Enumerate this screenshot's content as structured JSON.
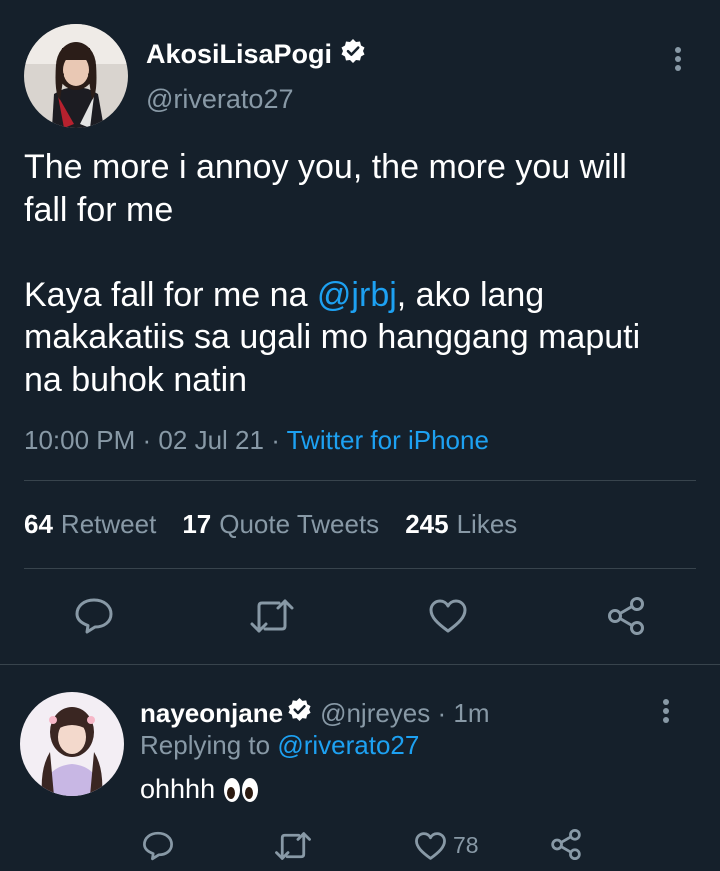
{
  "tweet": {
    "display_name": "AkosiLisaPogi",
    "handle": "@riverato27",
    "text_line1": "The more i annoy you, the more you will",
    "text_line2": "fall for me",
    "text_line3_pre": "Kaya fall for me na ",
    "mention": "@jrbj",
    "text_line3_post": ", ako lang",
    "text_line4": "makakatiis sa ugali mo hanggang maputi",
    "text_line5": "na buhok natin",
    "time": "10:00 PM",
    "date": "02 Jul 21",
    "source": "Twitter for iPhone",
    "stats": {
      "retweet_count": "64",
      "retweet_label": "Retweet",
      "quote_count": "17",
      "quote_label": "Quote Tweets",
      "like_count": "245",
      "like_label": "Likes"
    },
    "icons": [
      "reply-icon",
      "retweet-icon",
      "like-icon",
      "share-icon",
      "more-icon",
      "verified-icon"
    ]
  },
  "reply": {
    "display_name": "nayeonjane",
    "handle": "@njreyes",
    "age": "1m",
    "replying_label": "Replying to",
    "replying_to": "@riverato27",
    "text": "ohhhh",
    "emoji": "eyes-emoji",
    "like_count": "78"
  },
  "colors": {
    "background": "#15202b",
    "text": "#ffffff",
    "secondary": "#8899a6",
    "accent": "#1da1f2",
    "divider": "#38444d"
  }
}
